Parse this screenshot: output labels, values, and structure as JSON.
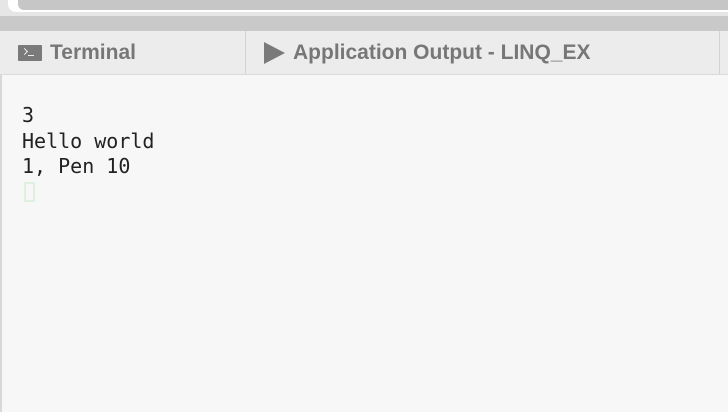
{
  "tabs": {
    "terminal": {
      "label": "Terminal",
      "icon": "terminal-icon"
    },
    "application_output": {
      "label": "Application Output - LINQ_EX",
      "icon": "play-icon"
    }
  },
  "console": {
    "lines": [
      "3",
      "Hello world",
      "1, Pen 10"
    ],
    "cursor_color": "#dff0e2"
  },
  "colors": {
    "tab_text": "#777777",
    "background": "#f7f7f7",
    "scrollbar_thumb": "#c6c6c6"
  }
}
